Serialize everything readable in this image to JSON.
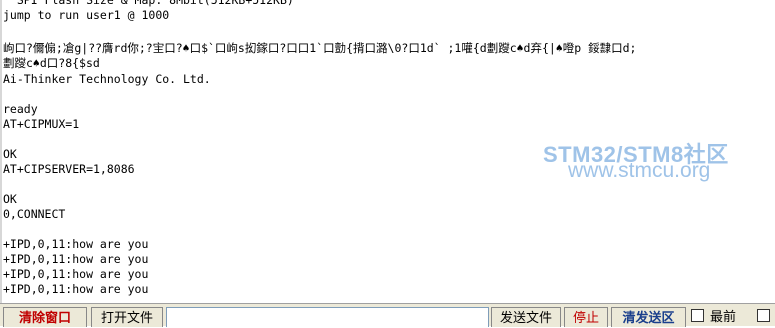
{
  "terminal": {
    "lines": [
      "  SPI Flash Size & Map: 8Mbit(512KB+512KB)",
      "jump to run user1 @ 1000",
      "",
      "岣口?儞傓;凔g|??膺rd你;?宔口?♠口$`口岣s抝鎵口?口口1`口勯{揹口潞\\0?口1d` ;1嚾{d劃躞c♠d弃{|♠噔p 鋖霴口d;",
      "劃躞c♠d口?8{$sd",
      "Ai-Thinker Technology Co. Ltd.",
      "",
      "ready",
      "AT+CIPMUX=1",
      "",
      "OK",
      "AT+CIPSERVER=1,8086",
      "",
      "OK",
      "0,CONNECT",
      "",
      "+IPD,0,11:how are you",
      "+IPD,0,11:how are you",
      "+IPD,0,11:how are you",
      "+IPD,0,11:how are you"
    ]
  },
  "watermark": {
    "title": "STM32/STM8社区",
    "url": "www.stmcu.org",
    "color": "#9fc3e8"
  },
  "toolbar": {
    "clear_window": "清除窗口",
    "open_file": "打开文件",
    "send_input_value": "",
    "send_file": "发送文件",
    "stop": "停止",
    "clear_send": "清发送区",
    "front_label": "最前",
    "accent_color": "#c00000",
    "clear_send_color": "#1a3f8c"
  }
}
